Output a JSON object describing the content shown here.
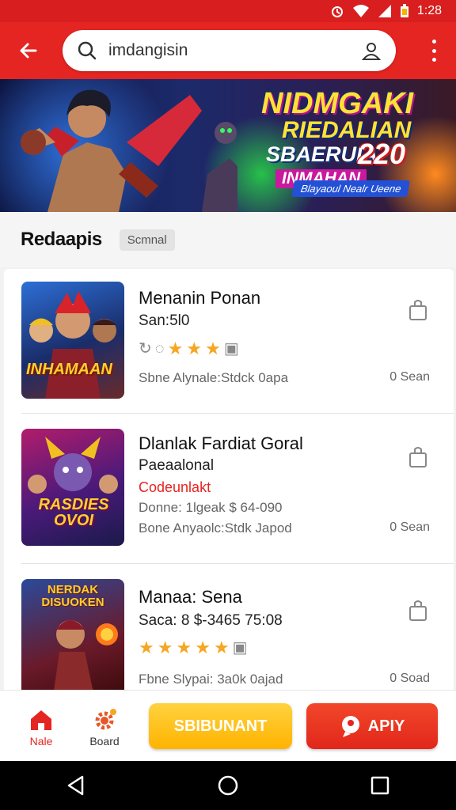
{
  "status_bar": {
    "time": "1:28"
  },
  "search": {
    "query": "imdangisin"
  },
  "banner": {
    "line1": "NIDMGAKI",
    "line2": "RIEDALIAN",
    "line3": "SBAERUIA",
    "year": "220",
    "line4": "INMAHAN",
    "tagline": "Blayaoul Nealr Ueene"
  },
  "section": {
    "title": "Redaapis",
    "chip": "Scmnal"
  },
  "items": [
    {
      "title": "Menanin Ponan",
      "subtitle": "San:5l0",
      "thumb_text": "INHAMAAN",
      "footer": "Sbne Alynale:Stdck 0apa",
      "right": "0 Sean"
    },
    {
      "title": "Dlanlak Fardiat Goral",
      "subtitle": "Paeaalonal",
      "highlight": "Codeunlakt",
      "price_line": "Donne: 1lgeak $ 64-090",
      "footer": "Bone Anyaolc:Stdk Japod",
      "thumb_text": "RASDIES OVOI",
      "right": "0 Sean"
    },
    {
      "title": "Manaa: Sena",
      "price_line": "Saca: 8 $-3465 75:08",
      "thumb_text": "NERDAK DISUOKEN",
      "footer": "Fbne Slypai: 3a0k 0ajad",
      "right": "0 Soad"
    }
  ],
  "bottom_nav": {
    "home_label": "Nale",
    "board_label": "Board",
    "primary_btn": "SBIBUNANT",
    "secondary_btn": "APIY"
  },
  "colors": {
    "brand_red": "#e52521",
    "accent_yellow": "#ffb300",
    "star": "#f5a623"
  }
}
